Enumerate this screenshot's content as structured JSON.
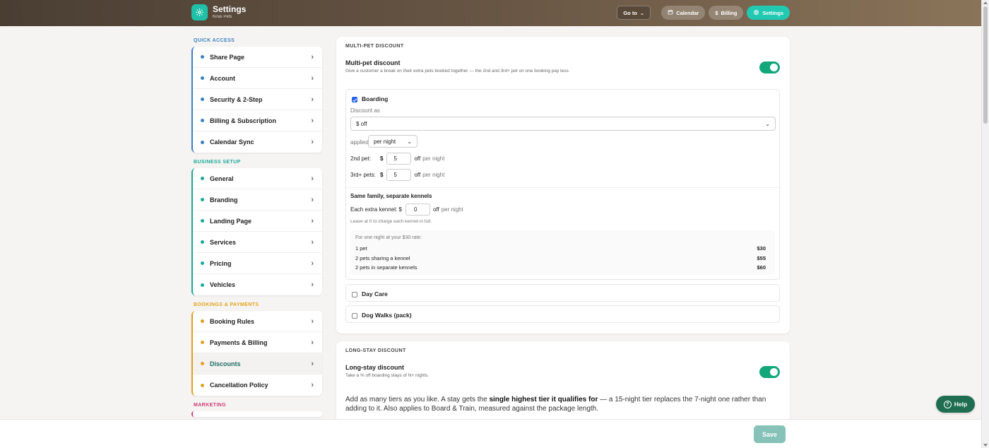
{
  "header": {
    "title": "Settings",
    "subtitle": "Kiras Pets",
    "goto_label": "Go to",
    "nav": [
      {
        "label": "Calendar",
        "icon": "calendar-icon"
      },
      {
        "label": "Billing",
        "icon": "dollar-icon"
      },
      {
        "label": "Settings",
        "icon": "gear-icon"
      }
    ]
  },
  "sidebar": {
    "quick_access": {
      "title": "QUICK ACCESS",
      "color": "#3b82c4",
      "items": [
        "Share Page",
        "Account",
        "Security & 2-Step",
        "Billing & Subscription",
        "Calendar Sync"
      ]
    },
    "business_setup": {
      "title": "BUSINESS SETUP",
      "color": "#1ba89a",
      "items": [
        "General",
        "Branding",
        "Landing Page",
        "Services",
        "Pricing",
        "Vehicles"
      ]
    },
    "bookings_payments": {
      "title": "BOOKINGS & PAYMENTS",
      "color": "#e3a21a",
      "items": [
        "Booking Rules",
        "Payments & Billing",
        "Discounts",
        "Cancellation Policy"
      ],
      "selected": "Discounts"
    },
    "marketing": {
      "title": "MARKETING",
      "color": "#d13a7a"
    }
  },
  "multi_pet": {
    "section_title": "MULTI-PET DISCOUNT",
    "heading": "Multi-pet discount",
    "description": "Give a customer a break on their extra pets booked together — the 2nd and 3rd+ pet on one booking pay less.",
    "enabled": true,
    "boarding": {
      "label": "Boarding",
      "checked": true,
      "discount_as_label": "Discount as",
      "discount_as_value": "$ off",
      "applied_label": "applied",
      "applied_value": "per night",
      "second_pet_label": "2nd pet:",
      "third_pet_label": "3rd+ pets:",
      "currency": "$",
      "second_pet_value": "5",
      "third_pet_value": "5",
      "off_label": "off",
      "per_night_label": "per night",
      "kennel_heading": "Same family, separate kennels",
      "extra_kennel_label": "Each extra kennel: $",
      "extra_kennel_value": "0",
      "kennel_hint": "Leave at 0 to charge each kennel in full.",
      "example_intro": "For one night at your $30 rate:",
      "examples": [
        {
          "label": "1 pet",
          "value": "$30"
        },
        {
          "label": "2 pets sharing a kennel",
          "value": "$55"
        },
        {
          "label": "2 pets in separate kennels",
          "value": "$60"
        }
      ]
    },
    "day_care": {
      "label": "Day Care",
      "checked": false
    },
    "dog_walks": {
      "label": "Dog Walks (pack)",
      "checked": false
    }
  },
  "long_stay": {
    "section_title": "LONG-STAY DISCOUNT",
    "heading": "Long-stay discount",
    "description": "Take a % off boarding stays of N+ nights.",
    "enabled": true,
    "para_before": "Add as many tiers as you like. A stay gets the ",
    "para_bold": "single highest tier it qualifies for",
    "para_after": " — a 15-night tier replaces the 7-night one rather than adding to it. Also applies to Board & Train, measured against the package length."
  },
  "footer": {
    "save_label": "Save"
  },
  "help": {
    "label": "Help"
  }
}
